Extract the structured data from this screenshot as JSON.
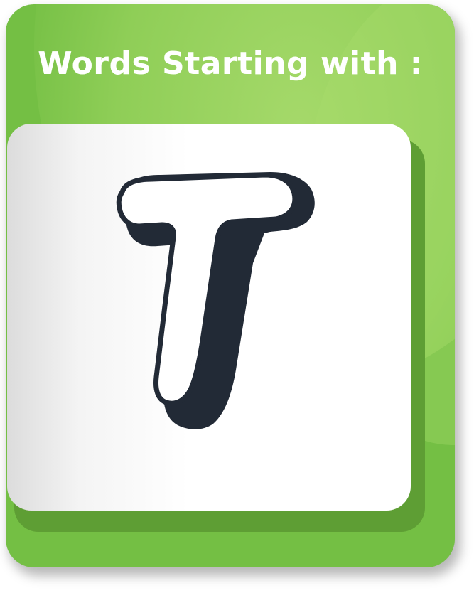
{
  "header": {
    "title": "Words Starting with :"
  },
  "letter_card": {
    "letter": "T",
    "letter_icon": "letter-t-icon"
  },
  "colors": {
    "card_green": "#74bf44",
    "card_highlight": "#a5d96a",
    "panel_depth": "#5e9e34",
    "panel_white": "#ffffff",
    "letter_fill": "#ffffff",
    "letter_outline": "#222a36"
  }
}
